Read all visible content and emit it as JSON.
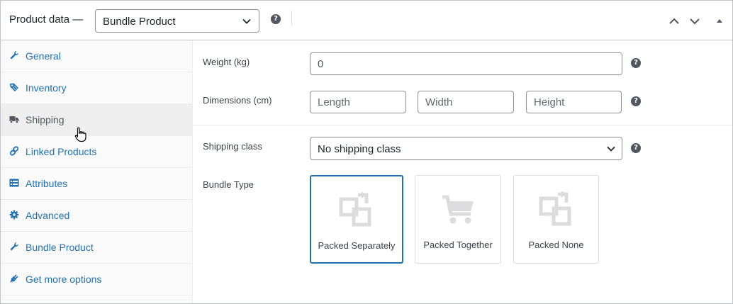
{
  "header": {
    "title": "Product data —",
    "product_type": "Bundle Product",
    "help": "?"
  },
  "sidebar": {
    "items": [
      {
        "label": "General",
        "icon": "wrench-icon"
      },
      {
        "label": "Inventory",
        "icon": "tag-icon"
      },
      {
        "label": "Shipping",
        "icon": "truck-icon",
        "active": true
      },
      {
        "label": "Linked Products",
        "icon": "link-icon"
      },
      {
        "label": "Attributes",
        "icon": "list-view-icon"
      },
      {
        "label": "Advanced",
        "icon": "gear-icon"
      },
      {
        "label": "Bundle Product",
        "icon": "wrench-icon"
      },
      {
        "label": "Get more options",
        "icon": "plugin-icon"
      }
    ]
  },
  "shipping": {
    "weight_label": "Weight (kg)",
    "weight_value": "0",
    "dimensions_label": "Dimensions (cm)",
    "length_placeholder": "Length",
    "width_placeholder": "Width",
    "height_placeholder": "Height",
    "class_label": "Shipping class",
    "class_value": "No shipping class",
    "bundle_type_label": "Bundle Type",
    "bundle_types": [
      {
        "label": "Packed Separately",
        "icon": "copy-icon",
        "selected": true
      },
      {
        "label": "Packed Together",
        "icon": "cart-icon"
      },
      {
        "label": "Packed None",
        "icon": "copy-icon"
      }
    ]
  },
  "colors": {
    "accent": "#2271b1",
    "link": "#2271b1",
    "icon_muted": "#dcdcde",
    "active_tab_bg": "#eeeeee"
  }
}
